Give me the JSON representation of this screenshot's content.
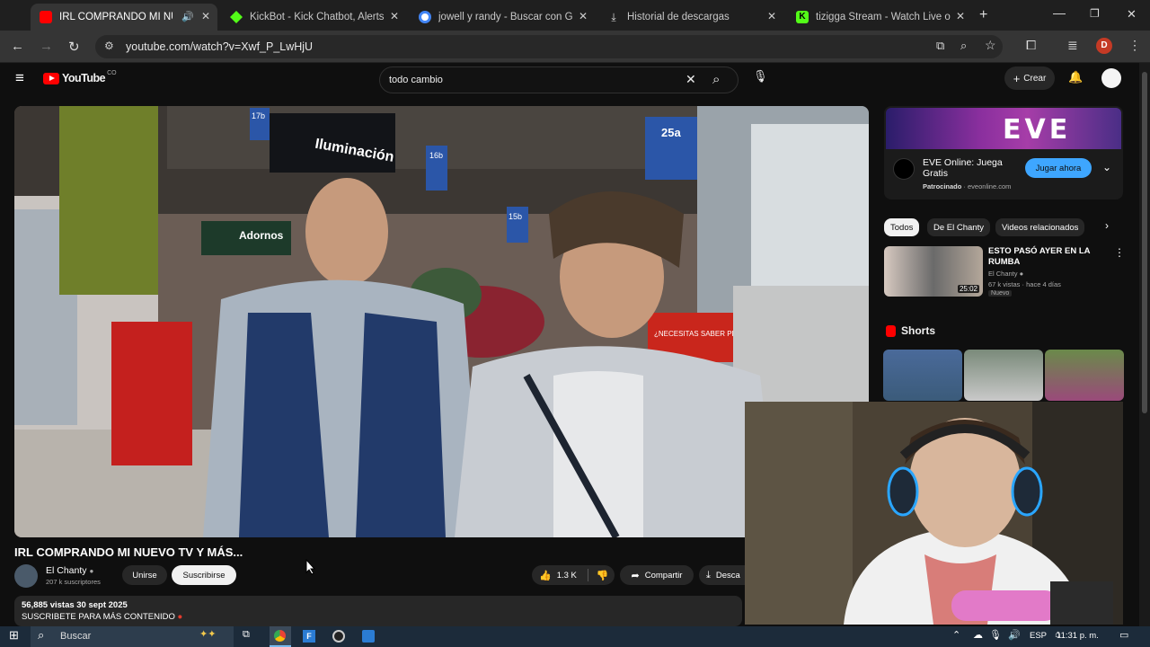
{
  "browser": {
    "tabs": [
      {
        "label": "IRL COMPRANDO MI NUEVO TV Y MÁS...",
        "icon": "youtube-icon",
        "color": "#ff0000"
      },
      {
        "label": "KickBot - Kick Chatbot, Alerts,",
        "icon": "kickbot-icon",
        "color": "#53fc18"
      },
      {
        "label": "jowell y randy - Buscar con Goo",
        "icon": "google-icon",
        "color": "#4285f4"
      },
      {
        "label": "Historial de descargas",
        "icon": "download-icon",
        "color": "#dddddd"
      },
      {
        "label": "tizigga Stream - Watch Live on",
        "icon": "kick-icon",
        "color": "#53fc18"
      }
    ],
    "url": "youtube.com/watch?v=Xwf_P_LwHjU",
    "profile_initial": "D"
  },
  "youtube": {
    "logo_text": "YouTube",
    "logo_sup": "CO",
    "search_value": "todo cambio",
    "create_label": "Crear"
  },
  "video": {
    "title": "IRL COMPRANDO MI NUEVO TV Y MÁS...",
    "channel": "El Chanty",
    "subscribers": "207 k suscriptores",
    "join_label": "Unirse",
    "subscribe_label": "Suscribirse",
    "likes": "1.3 K",
    "share_label": "Compartir",
    "download_label": "Desca",
    "views_date": "56,885 vistas  30 sept 2025",
    "description": "SUSCRIBETE PARA MÁS CONTENIDO",
    "store_signs": {
      "iluminacion": "Iluminación",
      "adornos": "Adornos",
      "aisle1": "17b",
      "aisle2": "16b",
      "aisle3": "25a",
      "aisle4": "15b",
      "promo": "¿NECESITAS SABER PRECIO?"
    }
  },
  "ad": {
    "banner_text": "EVE",
    "title": "EVE Online: Juega Gratis",
    "sponsored": "Patrocinado",
    "domain": "eveonline.com",
    "cta": "Jugar ahora"
  },
  "chips": [
    "Todos",
    "De El Chanty",
    "Videos relacionados"
  ],
  "related": {
    "title": "ESTO PASÓ AYER EN LA RUMBA",
    "channel": "El Chanty",
    "stats": "67 k vistas · hace 4 días",
    "badge": "Nuevo",
    "duration": "25:02"
  },
  "shorts_label": "Shorts",
  "taskbar": {
    "search_placeholder": "Buscar",
    "lang": "ESP",
    "time": "11:31 p. m."
  }
}
